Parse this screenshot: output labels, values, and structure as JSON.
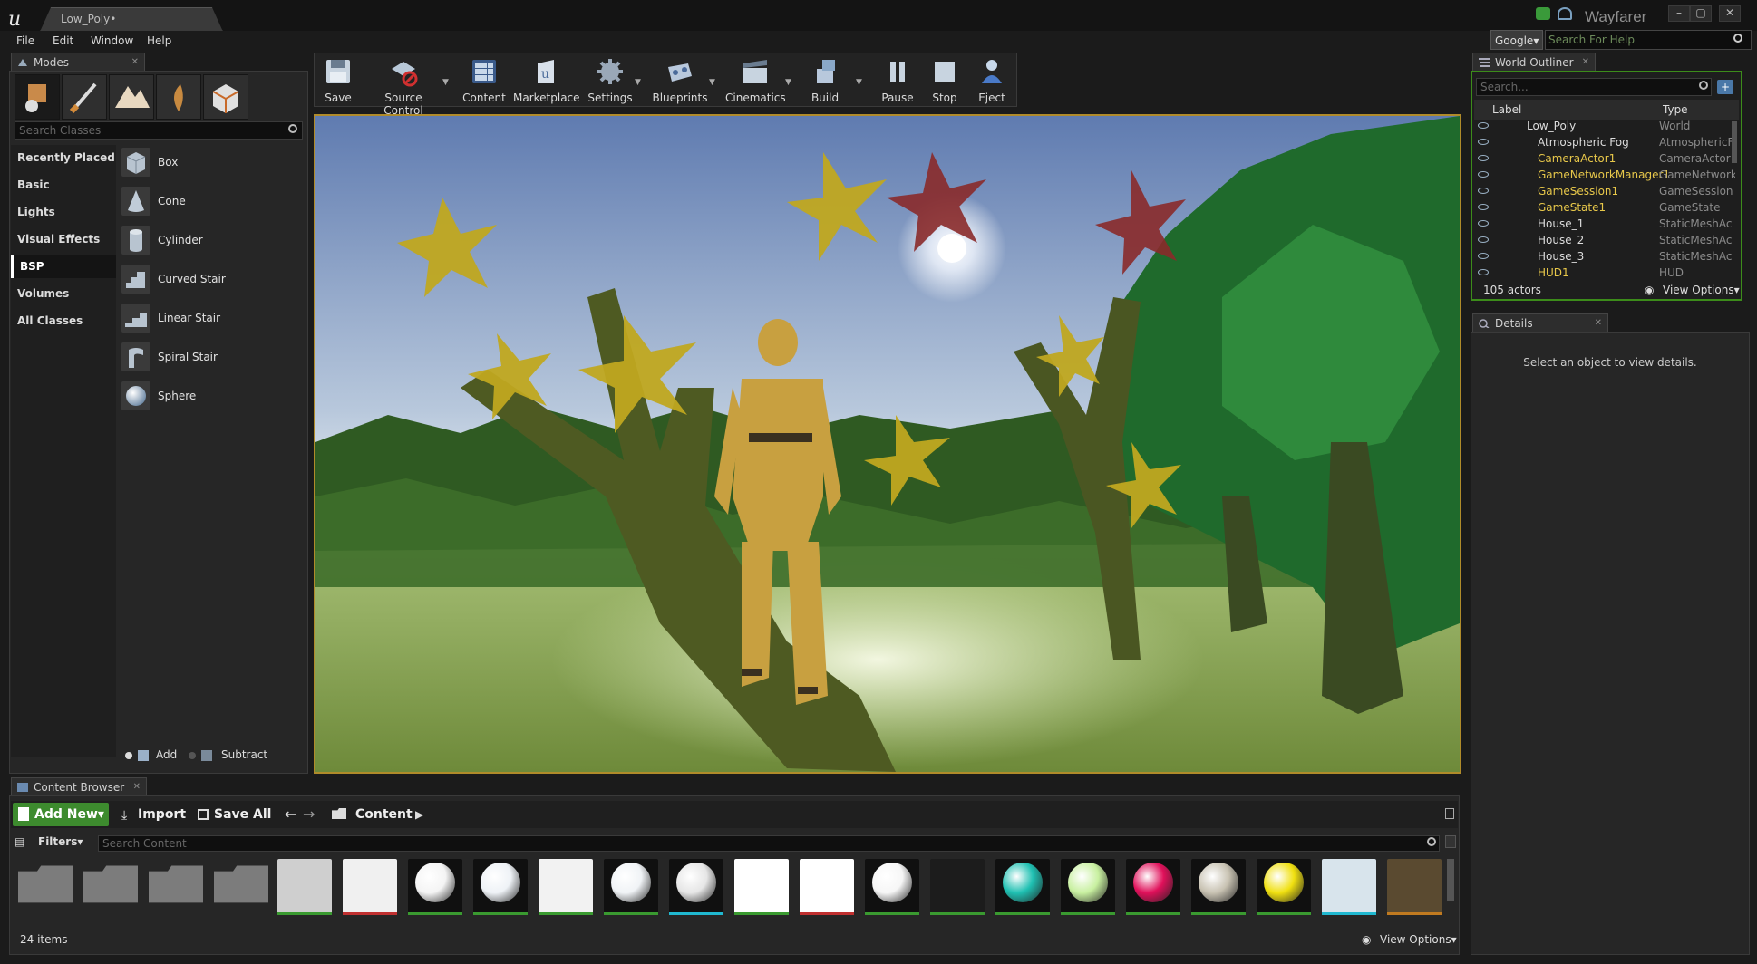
{
  "window": {
    "doc_tab": "Low_Poly•",
    "app_name": "Wayfarer",
    "controls": [
      "–",
      "▢",
      "✕"
    ]
  },
  "menu": {
    "items": [
      "File",
      "Edit",
      "Window",
      "Help"
    ],
    "search_engine": "Google▾",
    "help_placeholder": "Search For Help"
  },
  "modes": {
    "tab": "Modes",
    "search_placeholder": "Search Classes",
    "categories": [
      "Recently Placed",
      "Basic",
      "Lights",
      "Visual Effects",
      "BSP",
      "Volumes",
      "All Classes"
    ],
    "selected_category": "BSP",
    "items": [
      "Box",
      "Cone",
      "Cylinder",
      "Curved Stair",
      "Linear Stair",
      "Spiral Stair",
      "Sphere"
    ],
    "add_label": "Add",
    "subtract_label": "Subtract"
  },
  "toolbar": {
    "buttons": [
      "Save",
      "Source Control",
      "Content",
      "Marketplace",
      "Settings",
      "Blueprints",
      "Cinematics",
      "Build",
      "Pause",
      "Stop",
      "Eject"
    ]
  },
  "outliner": {
    "tab": "World Outliner",
    "search_placeholder": "Search...",
    "col_label": "Label",
    "col_type": "Type",
    "rows": [
      {
        "label": "Low_Poly",
        "type": "World"
      },
      {
        "label": "Atmospheric Fog",
        "type": "AtmosphericF"
      },
      {
        "label": "CameraActor1",
        "type": "CameraActor"
      },
      {
        "label": "GameNetworkManager1",
        "type": "GameNetwork"
      },
      {
        "label": "GameSession1",
        "type": "GameSession"
      },
      {
        "label": "GameState1",
        "type": "GameState"
      },
      {
        "label": "House_1",
        "type": "StaticMeshAc"
      },
      {
        "label": "House_2",
        "type": "StaticMeshAc"
      },
      {
        "label": "House_3",
        "type": "StaticMeshAc"
      },
      {
        "label": "HUD1",
        "type": "HUD"
      }
    ],
    "actor_count": "105 actors",
    "view_options": "View Options▾"
  },
  "details": {
    "tab": "Details",
    "empty_message": "Select an object to view details."
  },
  "content_browser": {
    "tab": "Content Browser",
    "add_new": "Add New▾",
    "import": "Import",
    "save_all": "Save All",
    "path": "Content",
    "filters": "Filters▾",
    "search_placeholder": "Search Content",
    "item_count": "24 items",
    "view_options": "View Options▾",
    "asset_colors": [
      "#8a8a8a",
      "#8a8a8a",
      "#8a8a8a",
      "#8a8a8a",
      "#cfcfcf",
      "#f0f0f0",
      "#f4f4f4",
      "#eef2f6",
      "#f2f2f2",
      "#f0f3f6",
      "#e6e6e6",
      "#ffffff",
      "#ffffff",
      "#f6f6f6",
      "#1c1c1c",
      "#1fc0b2",
      "#c8f0a0",
      "#e0105a",
      "#c8c2b2",
      "#f0e010",
      "#d8e4ec",
      "#5a4a30"
    ],
    "asset_bars": [
      "",
      "",
      "",
      "",
      "#3a9a30",
      "#c03030",
      "#3a9a30",
      "#3a9a30",
      "#3a9a30",
      "#3a9a30",
      "#20b8d0",
      "#3a9a30",
      "#c03030",
      "#3a9a30",
      "#3a9a30",
      "#3a9a30",
      "#3a9a30",
      "#3a9a30",
      "#3a9a30",
      "#3a9a30",
      "#20b8d0",
      "#c07a20"
    ]
  }
}
